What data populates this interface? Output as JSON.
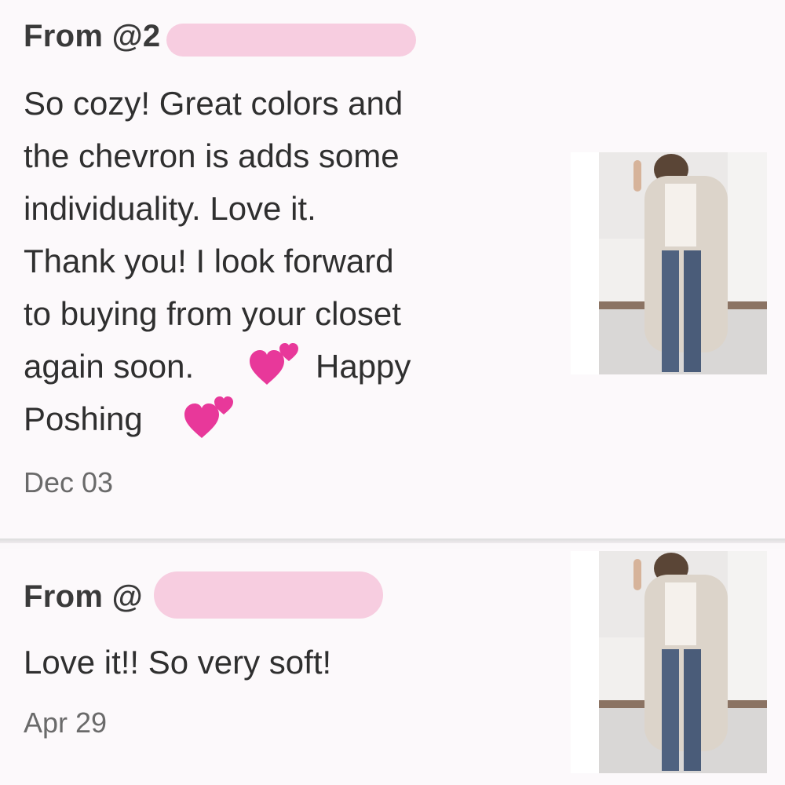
{
  "comments": [
    {
      "from_prefix": "From @2",
      "text": "So cozy! Great colors and\nthe chevron is adds some\nindividuality. Love it.\nThank you! I look forward\nto buying from your closet\nagain soon.",
      "text_after": "Happy",
      "text_end": "Poshing",
      "date": "Dec 03",
      "heart_icon": "two-hearts-icon"
    },
    {
      "from_prefix": "From @",
      "text": "Love it!! So very soft!",
      "date": "Apr 29"
    }
  ],
  "colors": {
    "background": "#fcf9fb",
    "redaction": "#f7cde0",
    "heart": "#e8389a"
  }
}
